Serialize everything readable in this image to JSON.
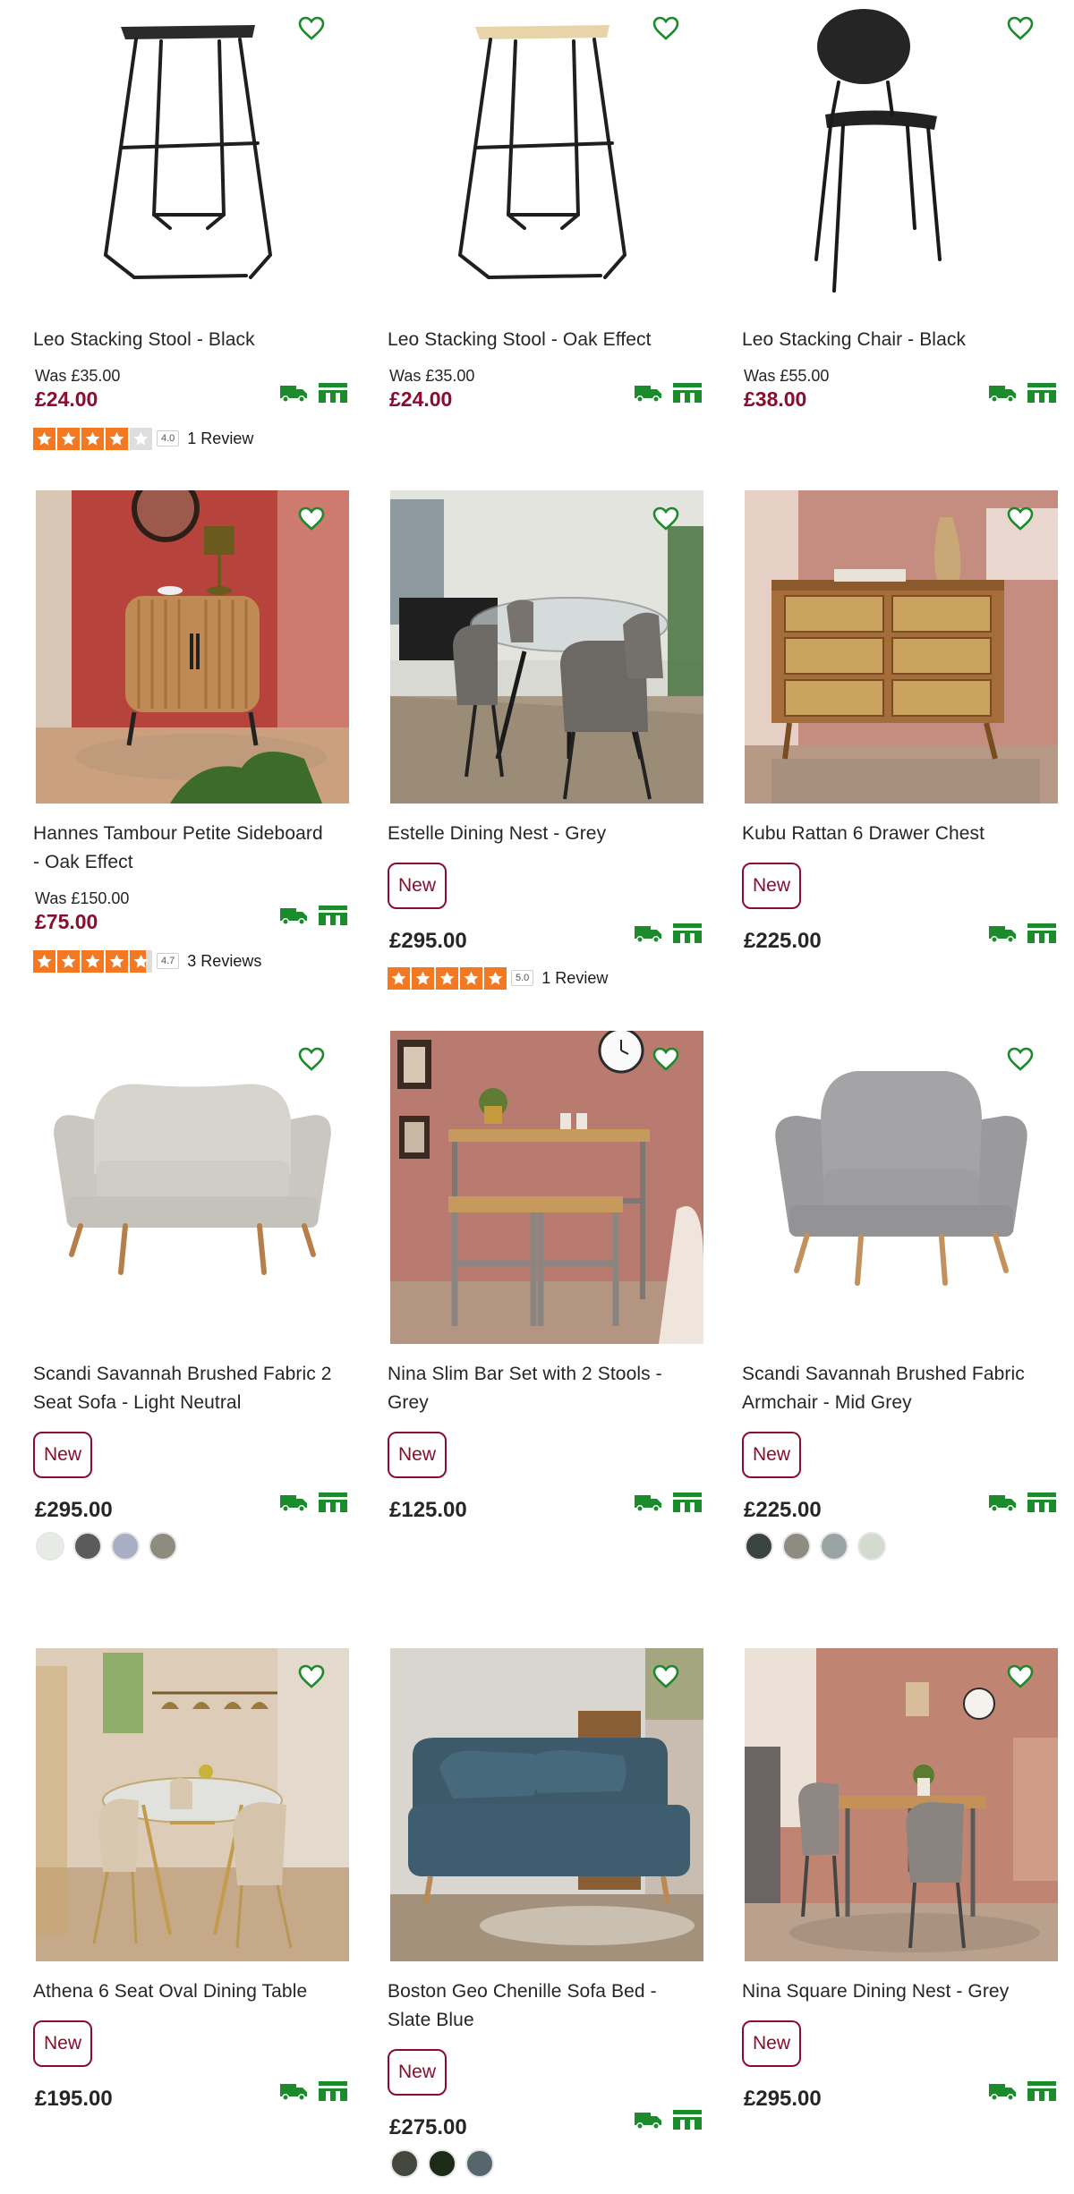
{
  "colors": {
    "sale": "#8a0c2e",
    "accent_green": "#1c8b2c",
    "star": "#f37821"
  },
  "products": [
    {
      "title_lines": [
        "Leo Stacking Stool - Black"
      ],
      "was": "Was £35.00",
      "price": "£24.00",
      "rating": {
        "score": "4.0",
        "reviews": "1 Review",
        "stars": 4
      }
    },
    {
      "title_lines": [
        "Leo Stacking Stool - Oak Effect"
      ],
      "was": "Was £35.00",
      "price": "£24.00"
    },
    {
      "title_lines": [
        "Leo Stacking Chair - Black"
      ],
      "was": "Was £55.00",
      "price": "£38.00"
    },
    {
      "title_lines": [
        "Hannes Tambour Petite Sideboard",
        "- Oak Effect"
      ],
      "was": "Was £150.00",
      "price": "£75.00",
      "rating": {
        "score": "4.7",
        "reviews": "3 Reviews",
        "stars": 4.7
      }
    },
    {
      "title_lines": [
        "Estelle Dining Nest - Grey"
      ],
      "badge": "New",
      "price": "£295.00",
      "rating": {
        "score": "5.0",
        "reviews": "1 Review",
        "stars": 5
      }
    },
    {
      "title_lines": [
        "Kubu Rattan 6 Drawer Chest"
      ],
      "badge": "New",
      "price": "£225.00"
    },
    {
      "title_lines": [
        "Scandi Savannah Brushed Fabric 2",
        "Seat Sofa - Light Neutral"
      ],
      "badge": "New",
      "price": "£295.00",
      "swatches": [
        "#e7ebe4",
        "#5b5b5e",
        "#a8aec3",
        "#8d8c7f"
      ]
    },
    {
      "title_lines": [
        "Nina Slim Bar Set with 2 Stools -",
        "Grey"
      ],
      "badge": "New",
      "price": "£125.00"
    },
    {
      "title_lines": [
        "Scandi Savannah Brushed Fabric",
        "Armchair - Mid Grey"
      ],
      "badge": "New",
      "price": "£225.00",
      "swatches": [
        "#3c4443",
        "#8e8b80",
        "#9aa4a4",
        "#d3dad0"
      ]
    },
    {
      "title_lines": [
        "Athena 6 Seat Oval Dining Table"
      ],
      "badge": "New",
      "price": "£195.00"
    },
    {
      "title_lines": [
        "Boston Geo Chenille Sofa Bed -",
        "Slate Blue"
      ],
      "badge": "New",
      "price": "£275.00",
      "swatches": [
        "#44473e",
        "#1c2a17",
        "#56666c"
      ]
    },
    {
      "title_lines": [
        "Nina Square Dining Nest - Grey"
      ],
      "badge": "New",
      "price": "£295.00"
    }
  ]
}
